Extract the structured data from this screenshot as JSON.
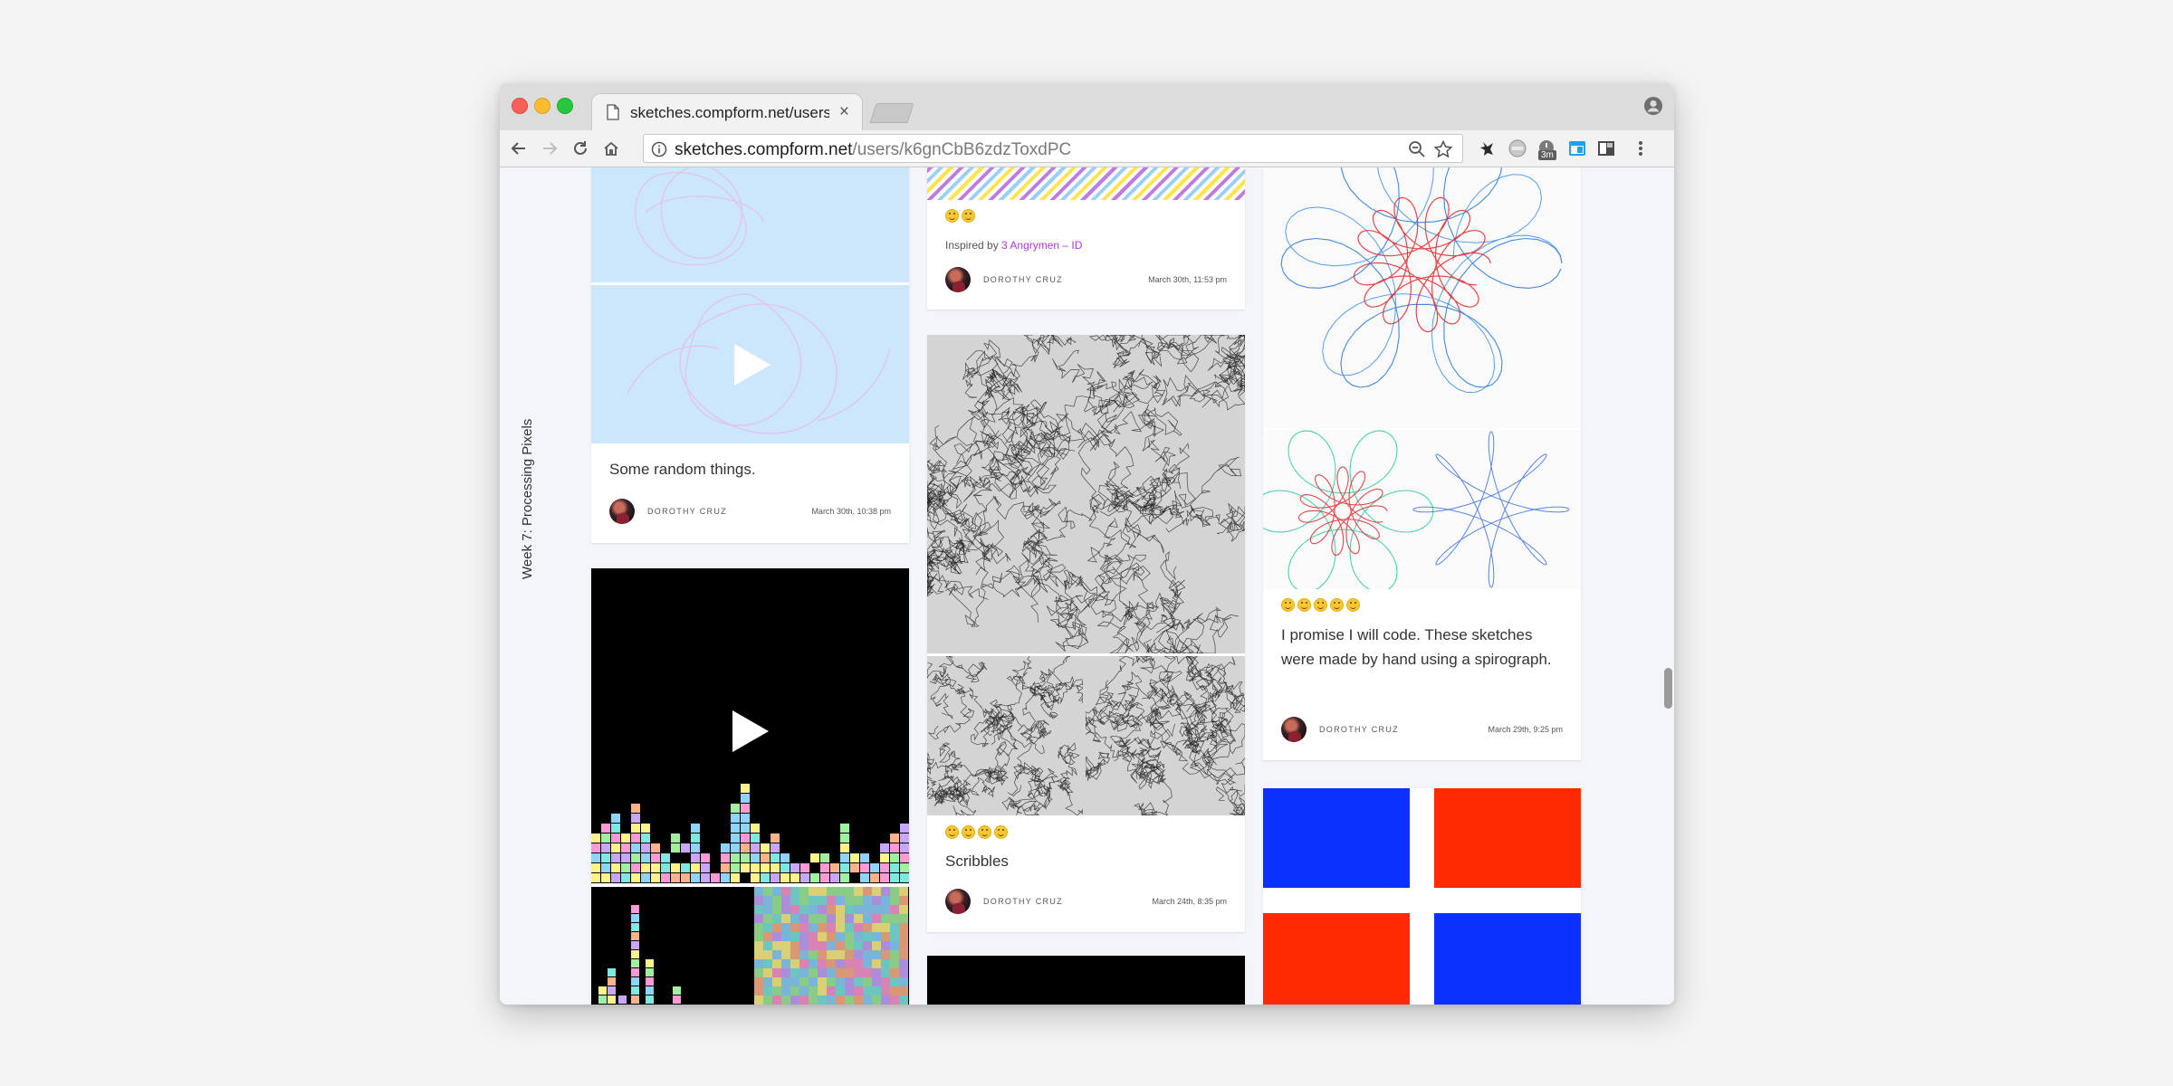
{
  "browser": {
    "tab_title": "sketches.compform.net/users/k6gnCbB6zdzToxdPC",
    "tab_close": "×",
    "url_host": "sketches.compform.net",
    "url_path": "/users/k6gnCbB6zdzToxdPC",
    "extension_badge": "3m"
  },
  "sidebar": {
    "section_label": "Week 7: Processing Pixels"
  },
  "posts": [
    {
      "caption": "Some random things.",
      "author": "DOROTHY CRUZ",
      "date": "March 30th, 10:38 pm"
    },
    {
      "inspired_prefix": "Inspired by",
      "inspired_link": "3 Angrymen – ID",
      "author": "DOROTHY CRUZ",
      "date": "March 30th, 11:53 pm",
      "reaction_count": 2
    },
    {
      "caption": "Scribbles",
      "author": "DOROTHY CRUZ",
      "date": "March 24th, 8:35 pm",
      "reaction_count": 4
    },
    {
      "caption": "I promise I will code. These sketches were made by hand using a spirograph.",
      "author": "DOROTHY CRUZ",
      "date": "March 29th, 9:25 pm",
      "reaction_count": 5
    },
    {
      "media": "video"
    },
    {
      "media": "image"
    },
    {
      "media": "image"
    }
  ],
  "colors": {
    "accent_link": "#a93ad8",
    "pastel_bg": "#cce6fb"
  }
}
